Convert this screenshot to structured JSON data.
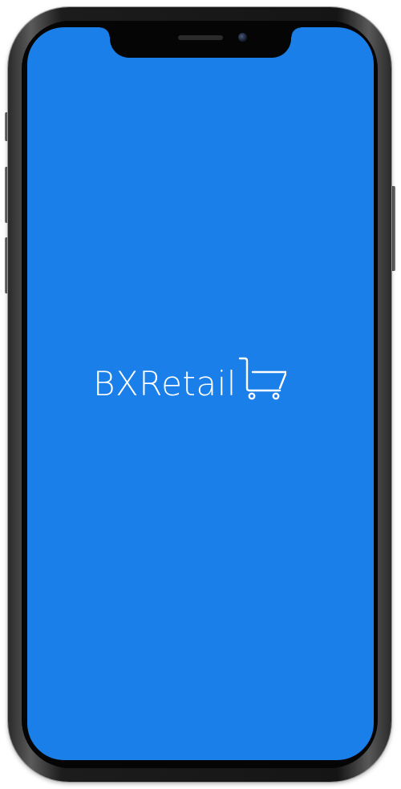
{
  "screen": {
    "background_color": "#1a7fe8",
    "frame_color": "#151515"
  },
  "logo": {
    "text": "BXRetail",
    "icon": "shopping-cart-icon",
    "color": "#ffffff"
  }
}
